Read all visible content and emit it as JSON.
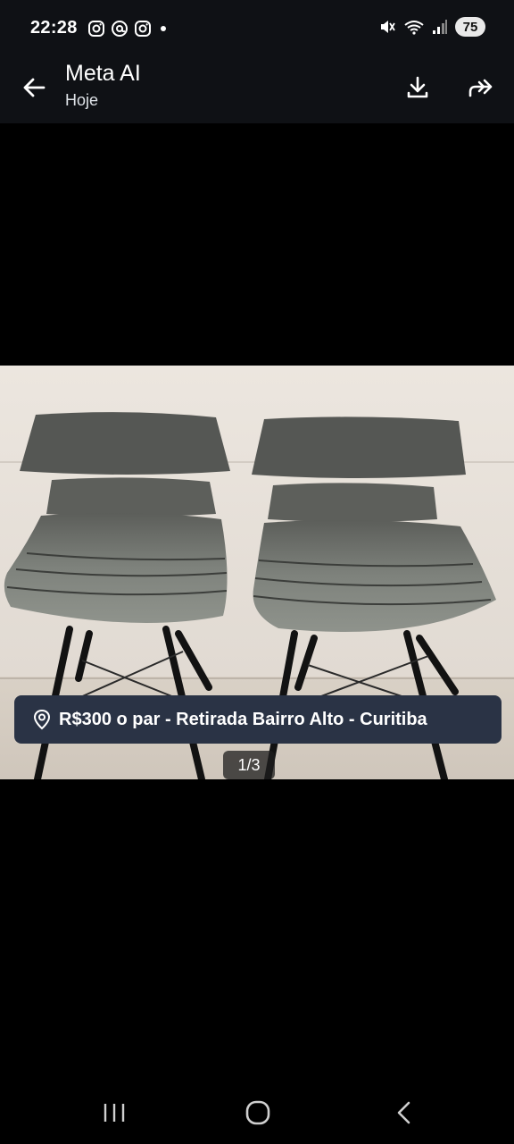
{
  "status_bar": {
    "time": "22:28",
    "battery": "75",
    "left_icons": [
      "instagram-icon",
      "threads-icon",
      "instagram-icon",
      "notification-dot-icon"
    ],
    "right_icons": [
      "mute-icon",
      "wifi-icon",
      "signal-icon",
      "battery-icon"
    ]
  },
  "header": {
    "title": "Meta AI",
    "subtitle": "Hoje",
    "icons": [
      "back-arrow-icon",
      "download-icon",
      "share-icon"
    ]
  },
  "listing": {
    "location_icon": "location-pin-icon",
    "price_text": "R$300 o par - Retirada Bairro Alto - Curitiba",
    "image_counter": "1/3"
  },
  "nav_bar": {
    "icons": [
      "recent-apps-icon",
      "home-icon",
      "back-icon"
    ]
  }
}
